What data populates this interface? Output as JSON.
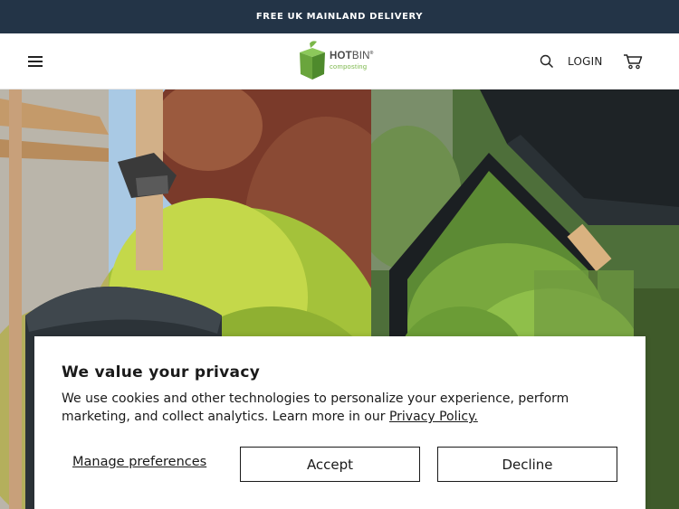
{
  "announcement": {
    "text": "FREE UK MAINLAND DELIVERY"
  },
  "header": {
    "logo": {
      "name_bold": "HOT",
      "name_regular": "BIN",
      "trademark": "®",
      "tagline": "composting"
    },
    "login_label": "LOGIN",
    "icons": {
      "menu": "hamburger-menu-icon",
      "search": "search-icon",
      "cart": "cart-icon"
    }
  },
  "hero": {
    "left_image": "garden-hotbin-photo",
    "right_image": "open-hotbin-grass-clippings-photo"
  },
  "cookie_banner": {
    "title": "We value your privacy",
    "body": "We use cookies and other technologies to personalize your experience, perform marketing, and collect analytics. Learn more in our",
    "privacy_link": "Privacy Policy.",
    "manage_label": "Manage preferences",
    "accept_label": "Accept",
    "decline_label": "Decline"
  },
  "colors": {
    "announcement_bg": "#233447",
    "brand_green": "#7ab648",
    "text": "#1a1a1a"
  }
}
